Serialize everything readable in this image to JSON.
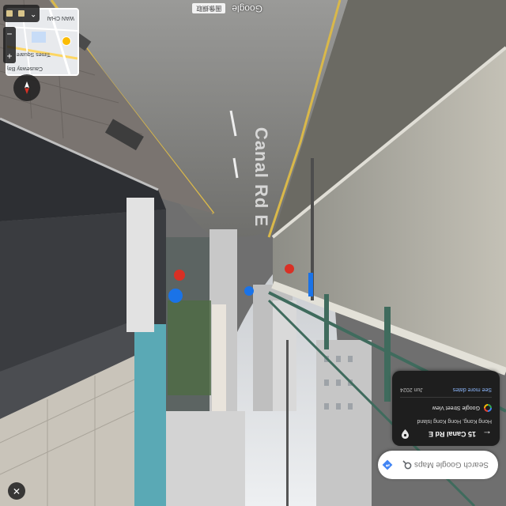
{
  "streetview": {
    "road_name": "Canal Rd E",
    "attribution_logo": "Google",
    "attribution_pill": "圖像擷取"
  },
  "search": {
    "placeholder": "Search Google Maps",
    "icon": "search-icon",
    "directions_icon": "directions-icon"
  },
  "place_card": {
    "title": "15 Canal Rd E",
    "address": "Hong Kong, Hong Kong Island",
    "source": "Google Street View",
    "date": "Jun 2024",
    "more_dates_label": "See more dates",
    "back_icon": "back-arrow-icon",
    "pin_icon": "location-pin-icon"
  },
  "minimap": {
    "labels": [
      "WAN CHAI",
      "Times Square",
      "Causeway Bay"
    ]
  },
  "controls": {
    "zoom_in": "+",
    "zoom_out": "−",
    "expand": "⌃",
    "close": "✕",
    "compass_icon": "compass-icon"
  },
  "colors": {
    "card_bg": "#1e1e1e",
    "link": "#8ab4f8",
    "search_bg": "#ffffff",
    "accent_blue": "#4285f4"
  }
}
